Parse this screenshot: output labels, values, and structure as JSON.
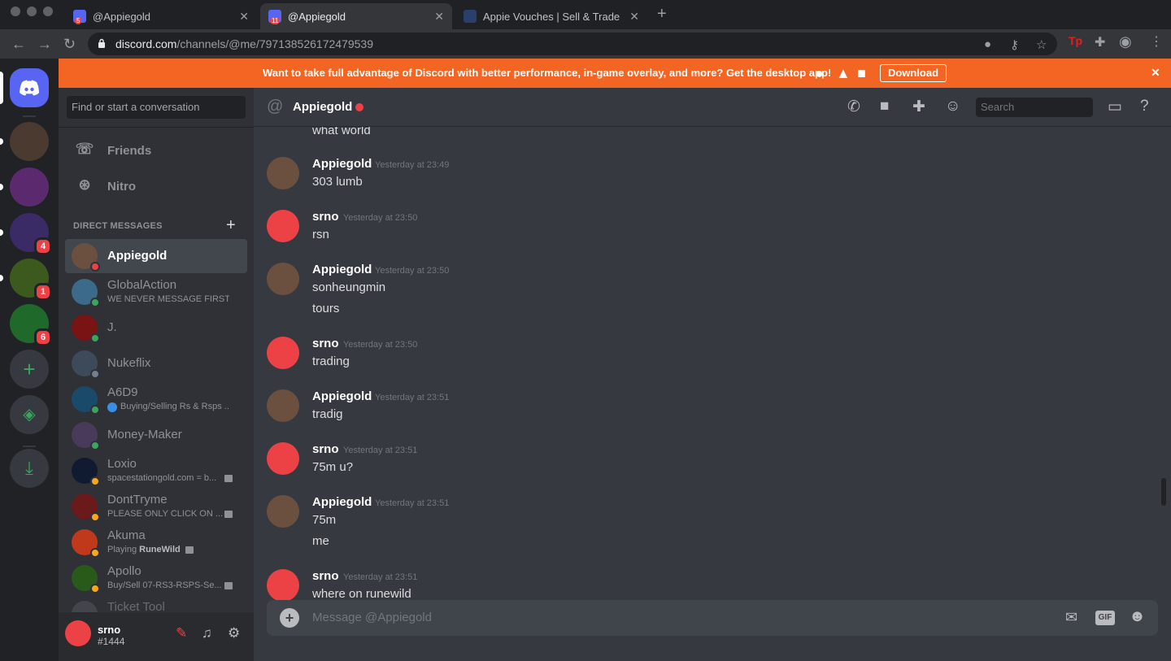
{
  "browser": {
    "tabs": [
      {
        "title": "@Appiegold",
        "badge": "5",
        "active": false
      },
      {
        "title": "@Appiegold",
        "badge": "11",
        "active": true
      },
      {
        "title": "Appie Vouches | Sell & Trade G",
        "badge": "",
        "active": false
      }
    ],
    "url_host": "discord.com",
    "url_path": "/channels/@me/797138526172479539"
  },
  "banner": {
    "message": "Want to take full advantage of Discord with better performance, in-game overlay, and more? Get the desktop app!",
    "download_label": "Download",
    "close": "✕"
  },
  "guilds": [
    {
      "name": "home",
      "color": "#5865f2",
      "badge": ""
    },
    {
      "name": "server-1",
      "color": "#4a3a30",
      "badge": ""
    },
    {
      "name": "server-2",
      "color": "#5b2a6e",
      "badge": ""
    },
    {
      "name": "server-3",
      "color": "#3a2a66",
      "badge": "4"
    },
    {
      "name": "server-4",
      "color": "#3d5a1e",
      "badge": "1"
    },
    {
      "name": "server-5",
      "color": "#1f6a2a",
      "badge": "6"
    }
  ],
  "sidebar": {
    "search_placeholder": "Find or start a conversation",
    "nav": [
      {
        "label": "Friends",
        "icon": "friends-icon"
      },
      {
        "label": "Nitro",
        "icon": "nitro-icon"
      }
    ],
    "dm_header": "DIRECT MESSAGES",
    "dms": [
      {
        "name": "Appiegold",
        "sub": "",
        "sub_bold": "",
        "status": "dnd",
        "color": "#6b5040",
        "active": true
      },
      {
        "name": "GlobalAction",
        "sub": "WE NEVER MESSAGE FIRST",
        "sub_bold": "",
        "status": "online",
        "color": "#3c6a8a"
      },
      {
        "name": "J.",
        "sub": "",
        "sub_bold": "",
        "status": "online",
        "color": "#7a1414"
      },
      {
        "name": "Nukeflix",
        "sub": "",
        "sub_bold": "",
        "status": "offline",
        "color": "#3d4a5a"
      },
      {
        "name": "A6D9",
        "sub": "Buying/Selling Rs & Rsps ...",
        "sub_bold": "",
        "status": "online",
        "color": "#1a4a6a"
      },
      {
        "name": "Money-Maker",
        "sub": "",
        "sub_bold": "",
        "status": "online",
        "color": "#4a3a5a"
      },
      {
        "name": "Loxio",
        "sub": "spacestationgold.com = b...",
        "sub_bold": "",
        "status": "idle",
        "color": "#101a30"
      },
      {
        "name": "DontTryme",
        "sub": "PLEASE ONLY CLICK ON ...",
        "sub_bold": "",
        "status": "idle",
        "color": "#6a1a1a"
      },
      {
        "name": "Akuma",
        "sub": "Playing ",
        "sub_bold": "RuneWild",
        "status": "idle",
        "color": "#c0391a"
      },
      {
        "name": "Apollo",
        "sub": "Buy/Sell 07-RS3-RSPS-Se...",
        "sub_bold": "",
        "status": "idle",
        "color": "#2a5a1a"
      },
      {
        "name": "Ticket Tool",
        "sub": "",
        "sub_bold": "",
        "status": "",
        "color": "#4f545c"
      }
    ],
    "user": {
      "name": "srno",
      "tag": "#1444"
    }
  },
  "chat": {
    "channel": "Appiegold",
    "search_placeholder": "Search",
    "orphan_line": "what world",
    "messages": [
      {
        "author": "Appiegold",
        "time": "Yesterday at 23:49",
        "lines": [
          "303 lumb"
        ],
        "self": false
      },
      {
        "author": "srno",
        "time": "Yesterday at 23:50",
        "lines": [
          "rsn"
        ],
        "self": true
      },
      {
        "author": "Appiegold",
        "time": "Yesterday at 23:50",
        "lines": [
          "sonheungmin",
          "tours"
        ],
        "self": false
      },
      {
        "author": "srno",
        "time": "Yesterday at 23:50",
        "lines": [
          "trading"
        ],
        "self": true
      },
      {
        "author": "Appiegold",
        "time": "Yesterday at 23:51",
        "lines": [
          "tradig"
        ],
        "self": false
      },
      {
        "author": "srno",
        "time": "Yesterday at 23:51",
        "lines": [
          "75m u?"
        ],
        "self": true
      },
      {
        "author": "Appiegold",
        "time": "Yesterday at 23:51",
        "lines": [
          "75m",
          "me"
        ],
        "self": false
      },
      {
        "author": "srno",
        "time": "Yesterday at 23:51",
        "lines": [
          "where on runewild"
        ],
        "self": true
      }
    ],
    "composer_placeholder": "Message @Appiegold",
    "gif_label": "GIF"
  },
  "colors": {
    "blurple": "#5865f2",
    "dnd": "#ed4245",
    "online": "#3ba55d",
    "idle": "#faa81a",
    "offline": "#747f8d",
    "banner": "#f26522"
  }
}
